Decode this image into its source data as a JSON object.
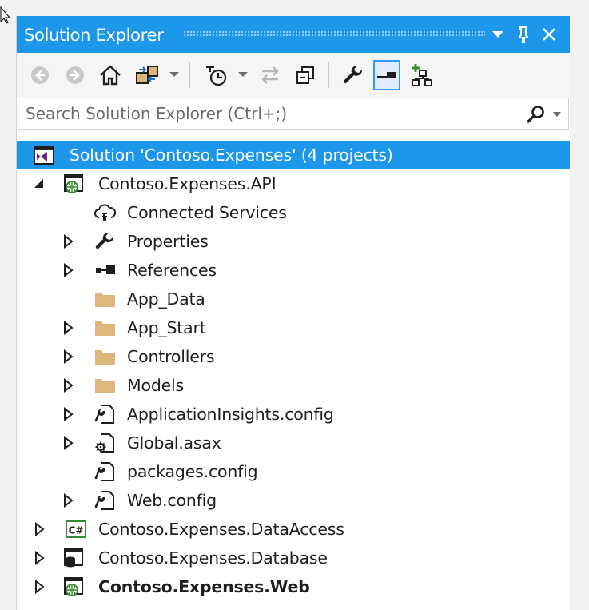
{
  "window": {
    "title": "Solution Explorer"
  },
  "search": {
    "placeholder": "Search Solution Explorer (Ctrl+;)"
  },
  "colors": {
    "titlebar": "#1c97ea",
    "selection": "#1c97ea",
    "folder": "#dcb67a"
  },
  "toolbar": {
    "items": [
      "back-icon",
      "forward-icon",
      "home-icon",
      "sync-icon",
      "history-icon",
      "switch-views-icon",
      "collapse-all-icon",
      "properties-icon",
      "preview-selected-icon",
      "new-solution-view-icon"
    ]
  },
  "tree": {
    "solution": "Solution 'Contoso.Expenses' (4 projects)",
    "api_project": "Contoso.Expenses.API",
    "connected_services": "Connected Services",
    "properties": "Properties",
    "references": "References",
    "app_data": "App_Data",
    "app_start": "App_Start",
    "controllers": "Controllers",
    "models": "Models",
    "application_insights": "ApplicationInsights.config",
    "global_asax": "Global.asax",
    "packages_config": "packages.config",
    "web_config": "Web.config",
    "dataaccess_project": "Contoso.Expenses.DataAccess",
    "database_project": "Contoso.Expenses.Database",
    "web_project": "Contoso.Expenses.Web"
  }
}
